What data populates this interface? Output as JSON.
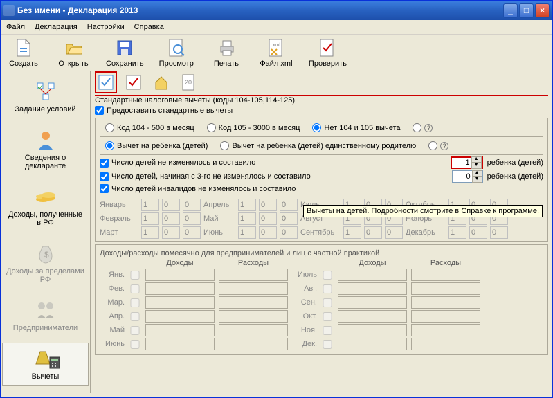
{
  "window": {
    "title": "Без имени - Декларация 2013"
  },
  "menubar": [
    "Файл",
    "Декларация",
    "Настройки",
    "Справка"
  ],
  "toolbar": [
    {
      "id": "create",
      "label": "Создать"
    },
    {
      "id": "open",
      "label": "Открыть"
    },
    {
      "id": "save",
      "label": "Сохранить"
    },
    {
      "id": "preview",
      "label": "Просмотр"
    },
    {
      "id": "print",
      "label": "Печать"
    },
    {
      "id": "filexml",
      "label": "Файл xml"
    },
    {
      "id": "check",
      "label": "Проверить"
    }
  ],
  "sidebar": [
    {
      "id": "conditions",
      "label": "Задание условий",
      "disabled": false
    },
    {
      "id": "declarant",
      "label": "Сведения о декларанте",
      "disabled": false
    },
    {
      "id": "income-rf",
      "label": "Доходы, полученные в РФ",
      "disabled": false
    },
    {
      "id": "income-abroad",
      "label": "Доходы за пределами РФ",
      "disabled": true
    },
    {
      "id": "entrepreneurs",
      "label": "Предприниматели",
      "disabled": true
    },
    {
      "id": "deductions",
      "label": "Вычеты",
      "selected": true
    }
  ],
  "deductions": {
    "section_title": "Стандартные налоговые вычеты (коды 104-105,114-125)",
    "provide_standard": {
      "checked": true,
      "label": "Предоставить стандартные вычеты"
    },
    "radio1": [
      {
        "id": "r104",
        "label": "Код 104 - 500 в месяц"
      },
      {
        "id": "r105",
        "label": "Код 105 - 3000 в месяц"
      },
      {
        "id": "rnone",
        "label": "Нет 104 и 105 вычета",
        "checked": true
      }
    ],
    "radio2": [
      {
        "id": "child",
        "label": "Вычет на ребенка (детей)",
        "checked": true
      },
      {
        "id": "childsingle",
        "label": "Вычет на ребенка (детей) единственному родителю"
      }
    ],
    "lines": {
      "l1": {
        "label": "Число детей не изменялось и составило",
        "value": "1",
        "suffix": "ребенка (детей)"
      },
      "l2": {
        "label": "Число детей, начиная с 3-го не изменялось и составило",
        "value": "0",
        "suffix": "ребенка (детей)"
      },
      "l3": {
        "label": "Число детей инвалидов не изменялось и составило",
        "value": "",
        "suffix": ""
      }
    },
    "tooltip": "Вычеты на детей. Подробности смотрите в Справке к программе.",
    "months": {
      "col1": [
        {
          "name": "Январь",
          "v": [
            "1",
            "0",
            "0"
          ]
        },
        {
          "name": "Февраль",
          "v": [
            "1",
            "0",
            "0"
          ]
        },
        {
          "name": "Март",
          "v": [
            "1",
            "0",
            "0"
          ]
        }
      ],
      "col2": [
        {
          "name": "Апрель",
          "v": [
            "1",
            "0",
            "0"
          ]
        },
        {
          "name": "Май",
          "v": [
            "1",
            "0",
            "0"
          ]
        },
        {
          "name": "Июнь",
          "v": [
            "1",
            "0",
            "0"
          ]
        }
      ],
      "col3": [
        {
          "name": "Июль",
          "v": [
            "1",
            "0",
            "0"
          ]
        },
        {
          "name": "Август",
          "v": [
            "1",
            "0",
            "0"
          ]
        },
        {
          "name": "Сентябрь",
          "v": [
            "1",
            "0",
            "0"
          ]
        }
      ],
      "col4": [
        {
          "name": "Октябрь",
          "v": [
            "1",
            "0",
            "0"
          ]
        },
        {
          "name": "Ноябрь",
          "v": [
            "1",
            "0",
            "0"
          ]
        },
        {
          "name": "Декабрь",
          "v": [
            "1",
            "0",
            "0"
          ]
        }
      ]
    },
    "income_panel": {
      "title": "Доходы/расходы помесячно для предпринимателей и лиц с частной практикой",
      "headers": [
        "Доходы",
        "Расходы",
        "Доходы",
        "Расходы"
      ],
      "rows": [
        {
          "m1": "Янв.",
          "m2": "Июль"
        },
        {
          "m1": "Фев.",
          "m2": "Авг."
        },
        {
          "m1": "Мар.",
          "m2": "Сен."
        },
        {
          "m1": "Апр.",
          "m2": "Окт."
        },
        {
          "m1": "Май",
          "m2": "Ноя."
        },
        {
          "m1": "Июнь",
          "m2": "Дек."
        }
      ]
    }
  }
}
